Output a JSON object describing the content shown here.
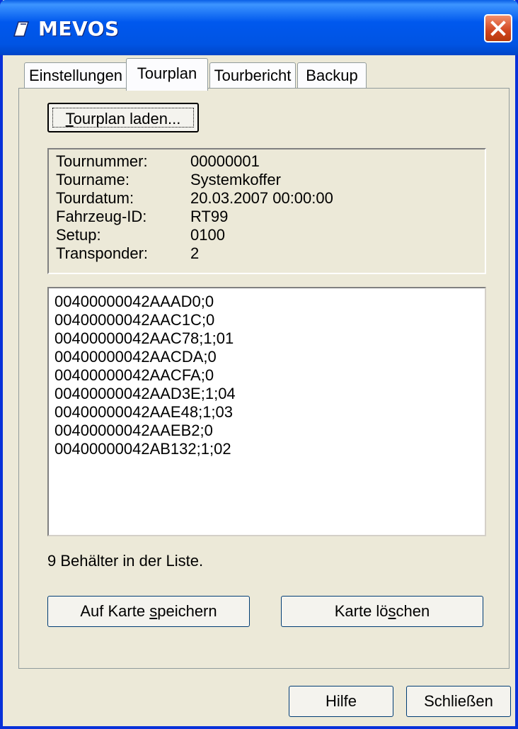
{
  "window": {
    "title": "MEVOS"
  },
  "tabs": [
    {
      "label": "Einstellungen"
    },
    {
      "label": "Tourplan"
    },
    {
      "label": "Tourbericht"
    },
    {
      "label": "Backup"
    }
  ],
  "tourplan": {
    "load_button": {
      "mnemonic": "T",
      "rest": "ourplan laden..."
    },
    "info": [
      {
        "label": "Tournummer:",
        "value": "00000001"
      },
      {
        "label": "Tourname:",
        "value": "Systemkoffer"
      },
      {
        "label": "Tourdatum:",
        "value": "20.03.2007 00:00:00"
      },
      {
        "label": "Fahrzeug-ID:",
        "value": "RT99"
      },
      {
        "label": "Setup:",
        "value": "0100"
      },
      {
        "label": "Transponder:",
        "value": "2"
      }
    ],
    "list": [
      "00400000042AAAD0;0",
      "00400000042AAC1C;0",
      "00400000042AAC78;1;01",
      "00400000042AACDA;0",
      "00400000042AACFA;0",
      "00400000042AAD3E;1;04",
      "00400000042AAE48;1;03",
      "00400000042AAEB2;0",
      "00400000042AB132;1;02"
    ],
    "status": "9 Behälter in der Liste.",
    "save_button": {
      "before": "Auf Karte ",
      "mnemonic": "s",
      "after": "peichern"
    },
    "delete_button": {
      "before": "Karte lö",
      "mnemonic": "s",
      "after": "chen"
    }
  },
  "footer": {
    "help_label": "Hilfe",
    "close_label": "Schließen"
  }
}
